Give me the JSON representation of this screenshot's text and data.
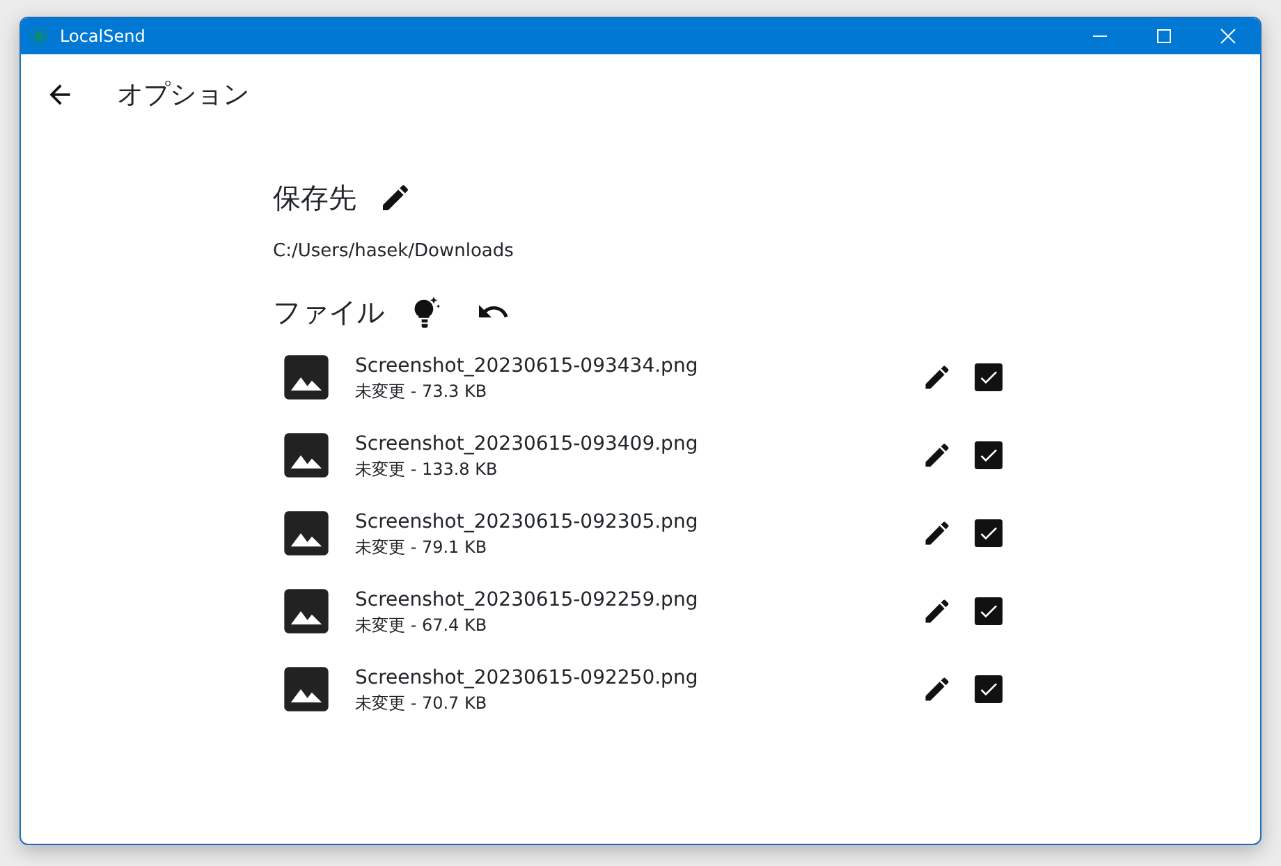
{
  "window": {
    "title": "LocalSend"
  },
  "header": {
    "title": "オプション"
  },
  "destination": {
    "heading": "保存先",
    "path": "C:/Users/hasek/Downloads"
  },
  "files_section": {
    "heading": "ファイル"
  },
  "files": [
    {
      "name": "Screenshot_20230615-093434.png",
      "info": "未変更 - 73.3 KB",
      "checked": true
    },
    {
      "name": "Screenshot_20230615-093409.png",
      "info": "未変更 - 133.8 KB",
      "checked": true
    },
    {
      "name": "Screenshot_20230615-092305.png",
      "info": "未変更 - 79.1 KB",
      "checked": true
    },
    {
      "name": "Screenshot_20230615-092259.png",
      "info": "未変更 - 67.4 KB",
      "checked": true
    },
    {
      "name": "Screenshot_20230615-092250.png",
      "info": "未変更 - 70.7 KB",
      "checked": true
    }
  ]
}
